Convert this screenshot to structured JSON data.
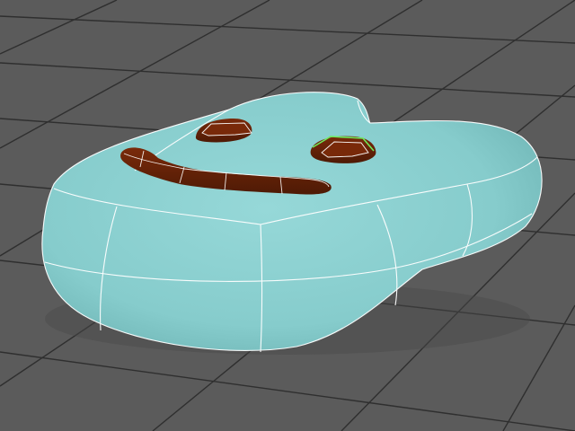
{
  "viewport": {
    "background_color": "#5b5b5b",
    "grid_line_color": "#2f2f2f"
  },
  "model": {
    "body_color": "#8ccfcf",
    "body_shadow_color": "#6fb6b6",
    "wireframe_color": "#ffffff",
    "selected_edge_color": "#6eea5a",
    "feature_color": "#5a1f06",
    "feature_top_color": "#7a2a0a",
    "parts": [
      {
        "name": "body",
        "icon": "rounded-blob"
      },
      {
        "name": "left-eye",
        "icon": "rounded-capsule"
      },
      {
        "name": "right-eye",
        "icon": "rounded-capsule"
      },
      {
        "name": "mouth",
        "icon": "curved-bar"
      }
    ]
  }
}
